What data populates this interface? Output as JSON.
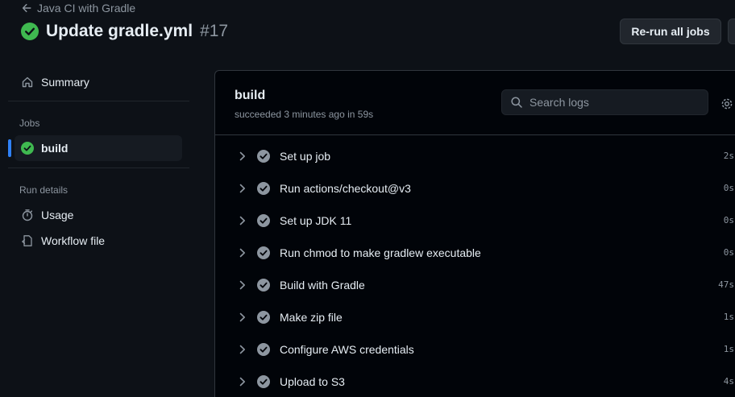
{
  "header": {
    "back_label": "Java CI with Gradle",
    "title": "Update gradle.yml",
    "run_number": "#17",
    "rerun_label": "Re-run all jobs",
    "status": "success"
  },
  "sidebar": {
    "summary_label": "Summary",
    "jobs_heading": "Jobs",
    "jobs": [
      {
        "label": "build",
        "status": "success"
      }
    ],
    "run_details_heading": "Run details",
    "usage_label": "Usage",
    "workflow_file_label": "Workflow file"
  },
  "job": {
    "name": "build",
    "status_text": "succeeded 3 minutes ago in 59s",
    "search_placeholder": "Search logs",
    "steps": [
      {
        "label": "Set up job",
        "duration": "2s"
      },
      {
        "label": "Run actions/checkout@v3",
        "duration": "0s"
      },
      {
        "label": "Set up JDK 11",
        "duration": "0s"
      },
      {
        "label": "Run chmod to make gradlew executable",
        "duration": "0s"
      },
      {
        "label": "Build with Gradle",
        "duration": "47s"
      },
      {
        "label": "Make zip file",
        "duration": "1s"
      },
      {
        "label": "Configure AWS credentials",
        "duration": "1s"
      },
      {
        "label": "Upload to S3",
        "duration": "4s"
      }
    ]
  },
  "colors": {
    "background": "#0d1117",
    "panel": "#010409",
    "success": "#3fb950",
    "step_check": "#8d96a0",
    "accent": "#2f81f7"
  }
}
